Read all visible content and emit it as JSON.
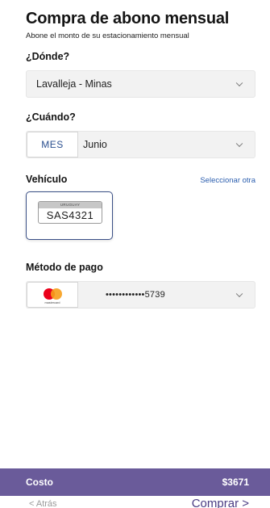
{
  "header": {
    "title": "Compra de abono mensual",
    "subtitle": "Abone el monto de su estacionamiento mensual"
  },
  "where": {
    "label": "¿Dónde?",
    "value": "Lavalleja - Minas"
  },
  "when": {
    "label": "¿Cuándo?",
    "period_tag": "MES",
    "value": "Junio"
  },
  "vehicle": {
    "label": "Vehículo",
    "select_other": "Seleccionar otra",
    "plate_country": "URUGUAY",
    "plate_number": "SAS4321"
  },
  "payment": {
    "label": "Método de pago",
    "card_brand": "mastercard",
    "card_masked": "••••••••••••5739"
  },
  "footer": {
    "cost_label": "Costo",
    "cost_value": "$3671",
    "back_label": "< Atrás",
    "buy_label": "Comprar >"
  },
  "colors": {
    "accent": "#6a5b9a",
    "link": "#2a5dae",
    "card_border": "#3a4f86"
  }
}
